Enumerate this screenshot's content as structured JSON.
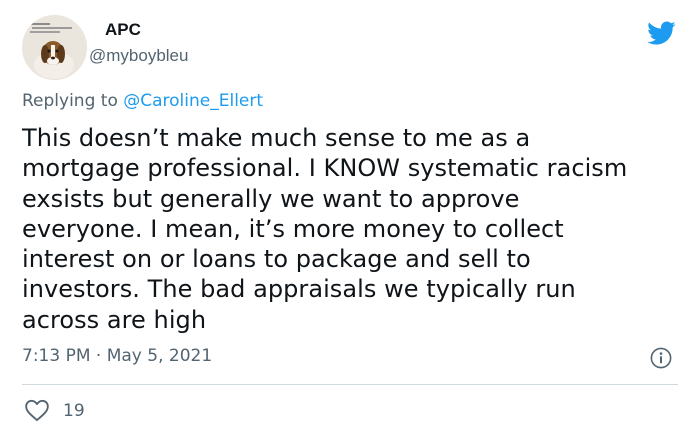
{
  "author": {
    "name": "APC",
    "handle": "@myboybleu"
  },
  "reply": {
    "prefix": "Replying to ",
    "mention": "@Caroline_Ellert"
  },
  "tweet": {
    "lines": [
      "This doesn’t make much sense to me as a",
      "mortgage professional. I KNOW systematic racism",
      "exsists but generally we want to approve",
      "everyone. I mean, it’s more money to collect",
      "interest on or loans to package and sell to",
      "investors. The bad appraisals we typically run",
      "across are high"
    ]
  },
  "meta": {
    "timestamp": "7:13 PM · May 5, 2021"
  },
  "actions": {
    "like_count": "19"
  },
  "icons": {
    "brand": "twitter-bird-icon",
    "info": "info-icon",
    "like": "heart-icon"
  },
  "colors": {
    "brand": "#1d9bf0",
    "secondary_text": "#536471",
    "divider": "#cfd9de"
  }
}
